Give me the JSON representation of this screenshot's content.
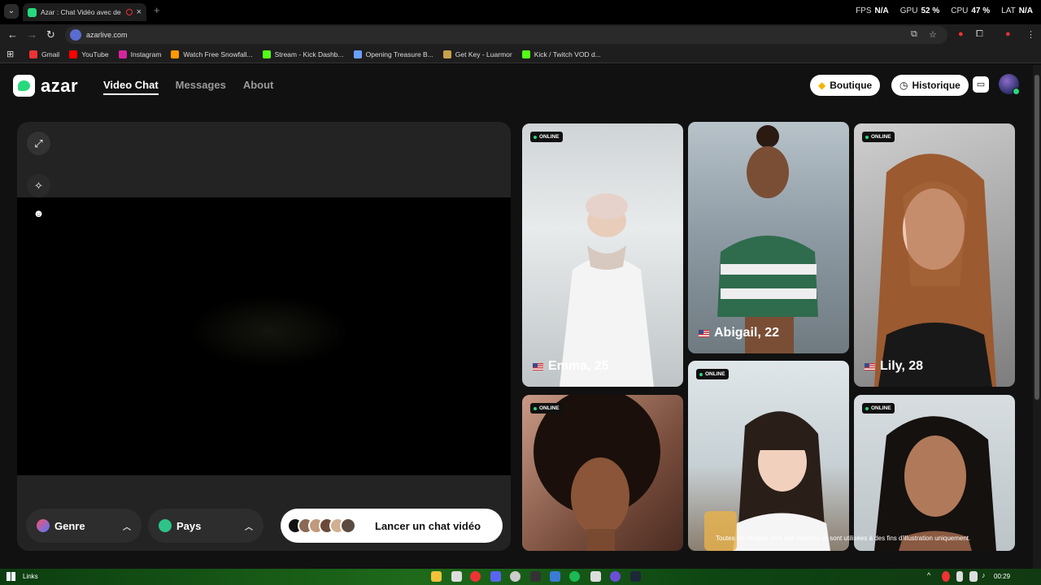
{
  "browser": {
    "tab_title": "Azar : Chat Vidéo avec de n",
    "url": "azarlive.com",
    "perf": [
      {
        "label": "FPS",
        "value": "N/A"
      },
      {
        "label": "GPU",
        "value": "52 %"
      },
      {
        "label": "CPU",
        "value": "47 %"
      },
      {
        "label": "LAT",
        "value": "N/A"
      }
    ],
    "bookmarks": [
      {
        "label": "Gmail",
        "color": "#e33"
      },
      {
        "label": "YouTube",
        "color": "#f00"
      },
      {
        "label": "Instagram",
        "color": "#d6249f"
      },
      {
        "label": "Watch Free Snowfall...",
        "color": "#f90"
      },
      {
        "label": "Stream - Kick Dashb...",
        "color": "#53fc18"
      },
      {
        "label": "Opening Treasure B...",
        "color": "#6aa0ff"
      },
      {
        "label": "Get Key - Luarmor",
        "color": "#c8a24a"
      },
      {
        "label": "Kick / Twitch VOD d...",
        "color": "#53fc18"
      }
    ]
  },
  "header": {
    "logo_text": "azar",
    "nav": [
      "Video Chat",
      "Messages",
      "About"
    ],
    "boutique_label": "Boutique",
    "historique_label": "Historique"
  },
  "video_panel": {
    "genre_label": "Genre",
    "pays_label": "Pays",
    "start_label": "Lancer un chat vidéo"
  },
  "gallery": {
    "badge": "ONLINE",
    "cards": [
      {
        "name": "Emma, 25",
        "online": true
      },
      {
        "name": "Abigail, 22",
        "online": false
      },
      {
        "name": "Lily, 28",
        "online": true
      },
      {
        "name": "",
        "online": true
      },
      {
        "name": "",
        "online": true
      },
      {
        "name": "",
        "online": true
      }
    ],
    "disclaimer": "Toutes les images sont des modèles et sont utilisées à des fins d'illustration uniquement."
  },
  "taskbar": {
    "links_label": "Links",
    "clock": "00:29"
  },
  "colors": {
    "accent": "#27d97d",
    "panel": "#232323"
  }
}
